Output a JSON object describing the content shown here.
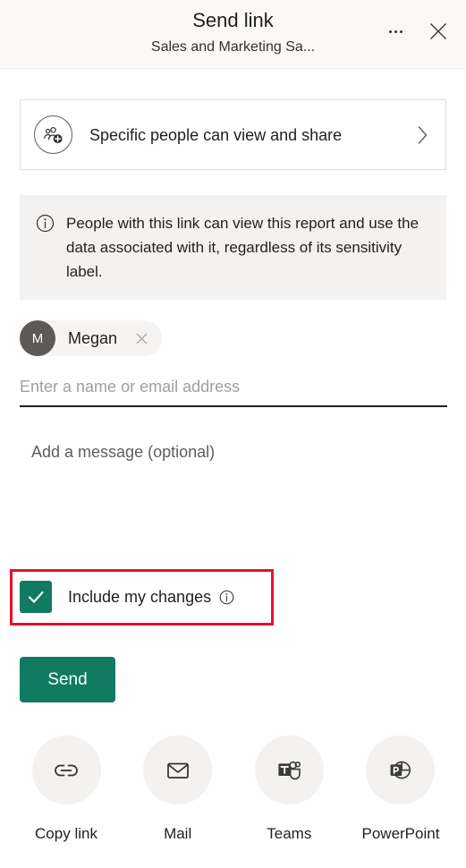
{
  "header": {
    "title": "Send link",
    "subtitle": "Sales and Marketing Sa...",
    "more_icon": "ellipsis-icon",
    "close_icon": "close-icon"
  },
  "permission": {
    "icon": "people-add-icon",
    "label": "Specific people can view and share",
    "chevron_icon": "chevron-right-icon"
  },
  "info_banner": {
    "icon": "info-circle-icon",
    "text": "People with this link can view this report and use the data associated with it, regardless of its sensitivity label."
  },
  "recipients": {
    "chips": [
      {
        "initial": "M",
        "name": "Megan",
        "remove_icon": "close-icon"
      }
    ],
    "input_value": "",
    "input_placeholder": "Enter a name or email address"
  },
  "message": {
    "value": "",
    "placeholder": "Add a message (optional)"
  },
  "include_changes": {
    "label": "Include my changes",
    "checked": true,
    "check_icon": "checkmark-icon",
    "info_icon": "info-circle-icon"
  },
  "send_button": {
    "label": "Send"
  },
  "share_targets": [
    {
      "label": "Copy link",
      "icon": "link-icon"
    },
    {
      "label": "Mail",
      "icon": "mail-icon"
    },
    {
      "label": "Teams",
      "icon": "teams-icon"
    },
    {
      "label": "PowerPoint",
      "icon": "powerpoint-icon"
    }
  ],
  "colors": {
    "accent_green": "#107a63",
    "annotation_red": "#e8102f",
    "header_bg": "#faf9f8",
    "banner_bg": "#f3f2f1",
    "avatar_gray": "#5d5a58"
  }
}
